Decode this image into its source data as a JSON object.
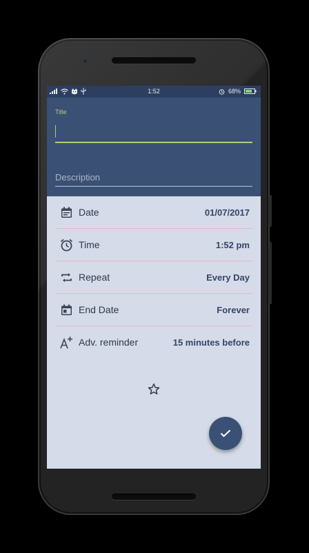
{
  "status_bar": {
    "time": "1:52",
    "battery_percent": "68%"
  },
  "form": {
    "title_label": "Title",
    "title_value": "",
    "description_placeholder": "Description"
  },
  "rows": [
    {
      "label": "Date",
      "value": "01/07/2017",
      "icon": "calendar-icon"
    },
    {
      "label": "Time",
      "value": "1:52 pm",
      "icon": "alarm-clock-icon"
    },
    {
      "label": "Repeat",
      "value": "Every Day",
      "icon": "repeat-icon"
    },
    {
      "label": "End Date",
      "value": "Forever",
      "icon": "calendar-end-icon"
    },
    {
      "label": "Adv. reminder",
      "value": "15 minutes before",
      "icon": "font-plus-icon"
    }
  ],
  "colors": {
    "header": "#3a5175",
    "accent": "#b9c97a",
    "background": "#d5dbe8",
    "value_text": "#34466a",
    "divider": "#e7b9bf"
  }
}
